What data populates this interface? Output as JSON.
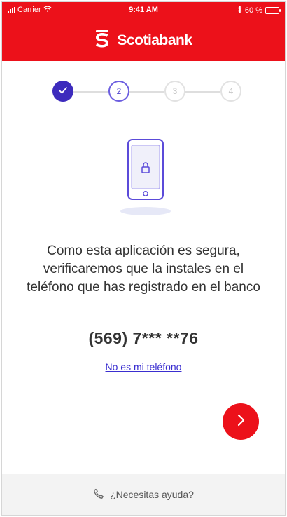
{
  "status_bar": {
    "carrier": "Carrier",
    "time": "9:41 AM",
    "battery_percent": "60 %",
    "battery_level": 0.6
  },
  "header": {
    "brand_name": "Scotiabank",
    "brand_color": "#ec111a"
  },
  "stepper": {
    "steps": [
      {
        "label": "",
        "state": "done"
      },
      {
        "label": "2",
        "state": "current"
      },
      {
        "label": "3",
        "state": "todo"
      },
      {
        "label": "4",
        "state": "todo"
      }
    ],
    "active_color": "#3d2bbd"
  },
  "illustration": {
    "icon": "phone-lock-icon"
  },
  "main": {
    "message_line1": "Como esta aplicación es segura,",
    "message_line2": "verificaremos que la instales en el",
    "message_line3": "teléfono que has registrado en el banco",
    "phone_number": "(569) 7*** **76",
    "not_mine_link": "No es mi teléfono",
    "next_icon": "chevron-right-icon"
  },
  "footer": {
    "help_label": "¿Necesitas ayuda?",
    "help_icon": "phone-icon"
  }
}
